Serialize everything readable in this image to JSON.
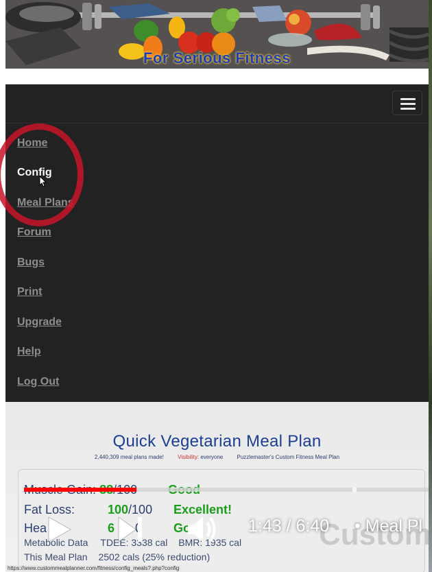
{
  "banner": {
    "title": "For Serious Fitness"
  },
  "nav": {
    "items": [
      {
        "label": "Home",
        "active": false
      },
      {
        "label": "Config",
        "active": true
      },
      {
        "label": "Meal Plans",
        "active": false
      },
      {
        "label": "Forum",
        "active": false
      },
      {
        "label": "Bugs",
        "active": false
      },
      {
        "label": "Print",
        "active": false
      },
      {
        "label": "Upgrade",
        "active": false
      },
      {
        "label": "Help",
        "active": false
      },
      {
        "label": "Log Out",
        "active": false
      }
    ],
    "menu_icon": "hamburger-menu-icon"
  },
  "content": {
    "title": "Quick Vegetarian Meal Plan",
    "meta": {
      "count": "2,440,309 meal plans made!",
      "visibility_label": "Visibility:",
      "visibility_value": "everyone",
      "owner": "Puzzlemaster's Custom Fitness Meal Plan"
    },
    "stats": [
      {
        "label": "Muscle Gain:",
        "value": "88",
        "max": "/100",
        "rating": "Good"
      },
      {
        "label": "Fat Loss:",
        "value": "100",
        "max": "/100",
        "rating": "Excellent!"
      },
      {
        "label": "Hea",
        "value": "6",
        "max": "0",
        "rating": "Go"
      }
    ],
    "metabolic": {
      "label": "Metabolic Data",
      "tdee": "TDEE: 3338 cal",
      "bmr": "BMR: 1935 cal"
    },
    "this_meal_plan": {
      "label": "This Meal Plan",
      "value": "2502 cals (25% reduction)"
    },
    "status_url": "https://www.custommealplanner.com/fitness/config_meals?.php?config",
    "watermark": "Custom"
  },
  "video": {
    "progress": 0.273,
    "current_time": "1:43",
    "separator": "/",
    "duration": "6:40",
    "chapter_sep": "•",
    "chapter": "Meal Pl",
    "colors": {
      "played": "#ff0000",
      "track": "#d2d2d2"
    },
    "icons": [
      "play-icon",
      "next-icon",
      "volume-icon"
    ]
  }
}
